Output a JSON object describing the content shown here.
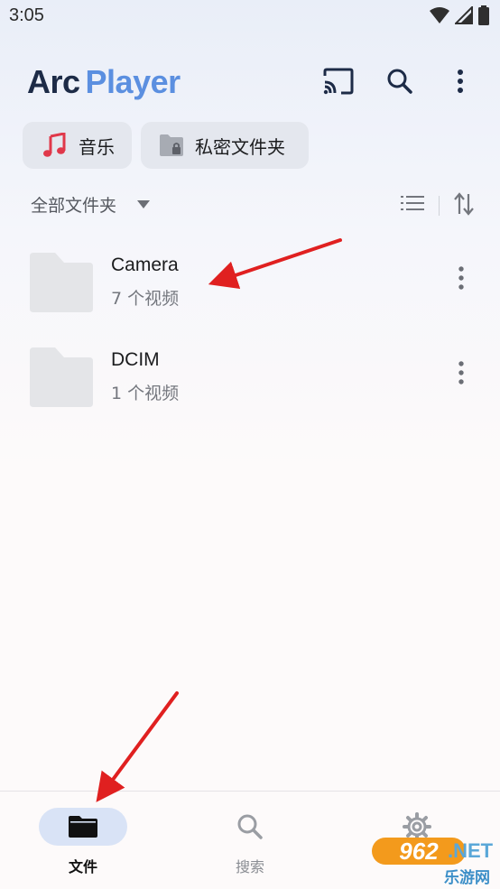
{
  "status_bar": {
    "time": "3:05"
  },
  "app": {
    "logo_part1": "Arc",
    "logo_part2": "Player"
  },
  "chips": [
    {
      "label": "音乐",
      "icon": "music-note-icon"
    },
    {
      "label": "私密文件夹",
      "icon": "locked-folder-icon"
    }
  ],
  "filter": {
    "label": "全部文件夹"
  },
  "folders": [
    {
      "name": "Camera",
      "count": "7 个视频"
    },
    {
      "name": "DCIM",
      "count": "1 个视频"
    }
  ],
  "nav": [
    {
      "label": "文件",
      "icon": "folder-icon",
      "active": true
    },
    {
      "label": "搜索",
      "icon": "search-icon",
      "active": false
    },
    {
      "label": "",
      "icon": "gear-icon",
      "active": false
    }
  ],
  "watermark": {
    "brand_number": "962",
    "brand_domain": ".NET",
    "brand_name": "乐游网"
  },
  "colors": {
    "accent": "#5b8fe0",
    "nav_active_pill": "#d9e3f6",
    "annotation_arrow": "#e02020"
  }
}
